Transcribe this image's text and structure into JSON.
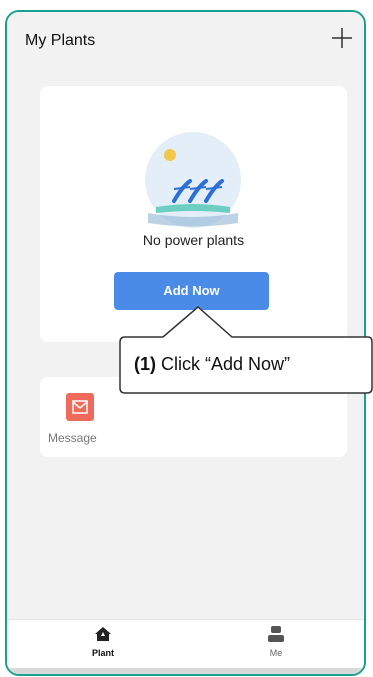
{
  "header": {
    "title": "My Plants",
    "add_icon": "plus-icon"
  },
  "empty_state": {
    "illustration_icon": "solar-panels-icon",
    "text": "No power plants",
    "button_label": "Add Now"
  },
  "message_card": {
    "icon": "envelope-icon",
    "label": "Message"
  },
  "tabbar": {
    "tabs": [
      {
        "label": "Plant",
        "icon": "home-icon",
        "active": true
      },
      {
        "label": "Me",
        "icon": "person-icon",
        "active": false
      }
    ]
  },
  "callout": {
    "step": "(1)",
    "text": "Click “Add Now”"
  },
  "colors": {
    "frame_border": "#1aa08e",
    "accent_button": "#4b8be8",
    "message_icon_bg": "#ef6a5a",
    "illustration_bg": "#e3eef8"
  }
}
